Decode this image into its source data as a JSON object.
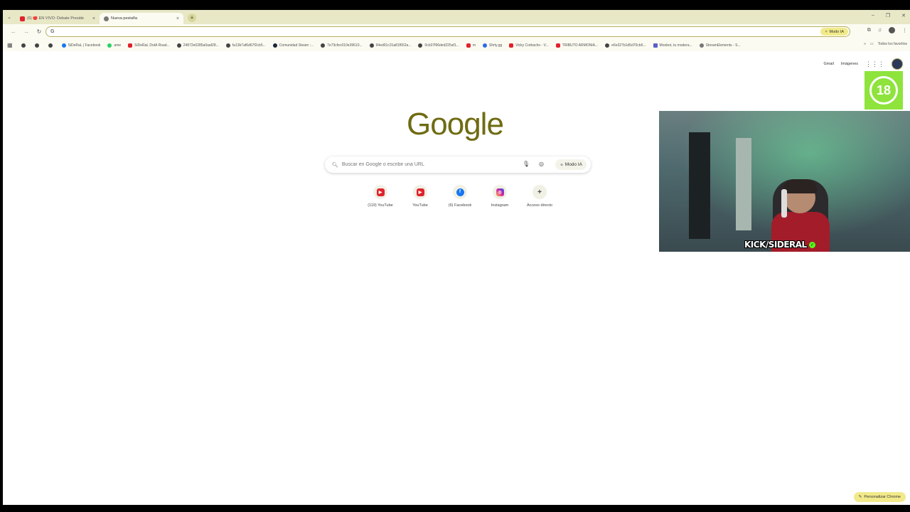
{
  "tabs": [
    {
      "title": "(6) 🔴 EN VIVO: Debate Preside",
      "favicon_color": "#e0222b",
      "active": false
    },
    {
      "title": "Nueva pestaña",
      "favicon_color": "#777777",
      "active": true
    }
  ],
  "omnibox": {
    "value": "",
    "modo_ia_label": "Modo IA"
  },
  "bookmarks": [
    {
      "label": "",
      "color": "#444444"
    },
    {
      "label": "",
      "color": "#444444"
    },
    {
      "label": "",
      "color": "#444444"
    },
    {
      "label": "SiDeRaL | Facebook",
      "color": "#1877f2"
    },
    {
      "label": "ame",
      "color": "#25d366"
    },
    {
      "label": "SiDeRaL DotA Road...",
      "color": "#e0222b"
    },
    {
      "label": "24872e0285a0aaf28...",
      "color": "#444444"
    },
    {
      "label": "fa13b7af6d67f2cb5...",
      "color": "#444444"
    },
    {
      "label": "Comunidad Steam :...",
      "color": "#1b2838"
    },
    {
      "label": "7e73cfec010e39610...",
      "color": "#444444"
    },
    {
      "label": "94ed01c31a81f652a...",
      "color": "#444444"
    },
    {
      "label": "0cb37f66ded225af1...",
      "color": "#444444"
    },
    {
      "label": "m",
      "color": "#e0222b"
    },
    {
      "label": "Shrty.gg",
      "color": "#2e6be6"
    },
    {
      "label": "Vicky Corbacho - V...",
      "color": "#e0222b"
    },
    {
      "label": "TRIBUTO ARMONIA...",
      "color": "#e0222b"
    },
    {
      "label": "e6e327b1d5d70cb6...",
      "color": "#444444"
    },
    {
      "label": "Moobot, tu modera...",
      "color": "#5b5fc7"
    },
    {
      "label": "StreamElements - S...",
      "color": "#777777"
    }
  ],
  "bookmarks_all": "Todos los favoritos",
  "page": {
    "gmail": "Gmail",
    "images": "Imágenes",
    "logo": "Google",
    "search_placeholder": "Buscar en Google o escribir una URL",
    "modo_ia": "Modo IA",
    "shortcuts": [
      {
        "label": "(119) YouTube",
        "icon": "youtube-icon",
        "color": "#e0222b"
      },
      {
        "label": "YouTube",
        "icon": "youtube-icon",
        "color": "#e0222b"
      },
      {
        "label": "(6) Facebook",
        "icon": "facebook-icon",
        "color": "#1877f2"
      },
      {
        "label": "Instagram",
        "icon": "instagram-icon",
        "color": "#d6249f"
      },
      {
        "label": "Acceso directo",
        "icon": "plus-icon",
        "color": "#444444"
      }
    ],
    "personalize": "Personalizar Chrome"
  },
  "overlay": {
    "age_badge": "18",
    "streamer_tag": "KICK/SIDERAL",
    "badge_color": "#8ee33c"
  },
  "colors": {
    "tabstrip": "#e8e7c6",
    "accent": "#f2ea8a",
    "logo": "#6f6b12"
  }
}
